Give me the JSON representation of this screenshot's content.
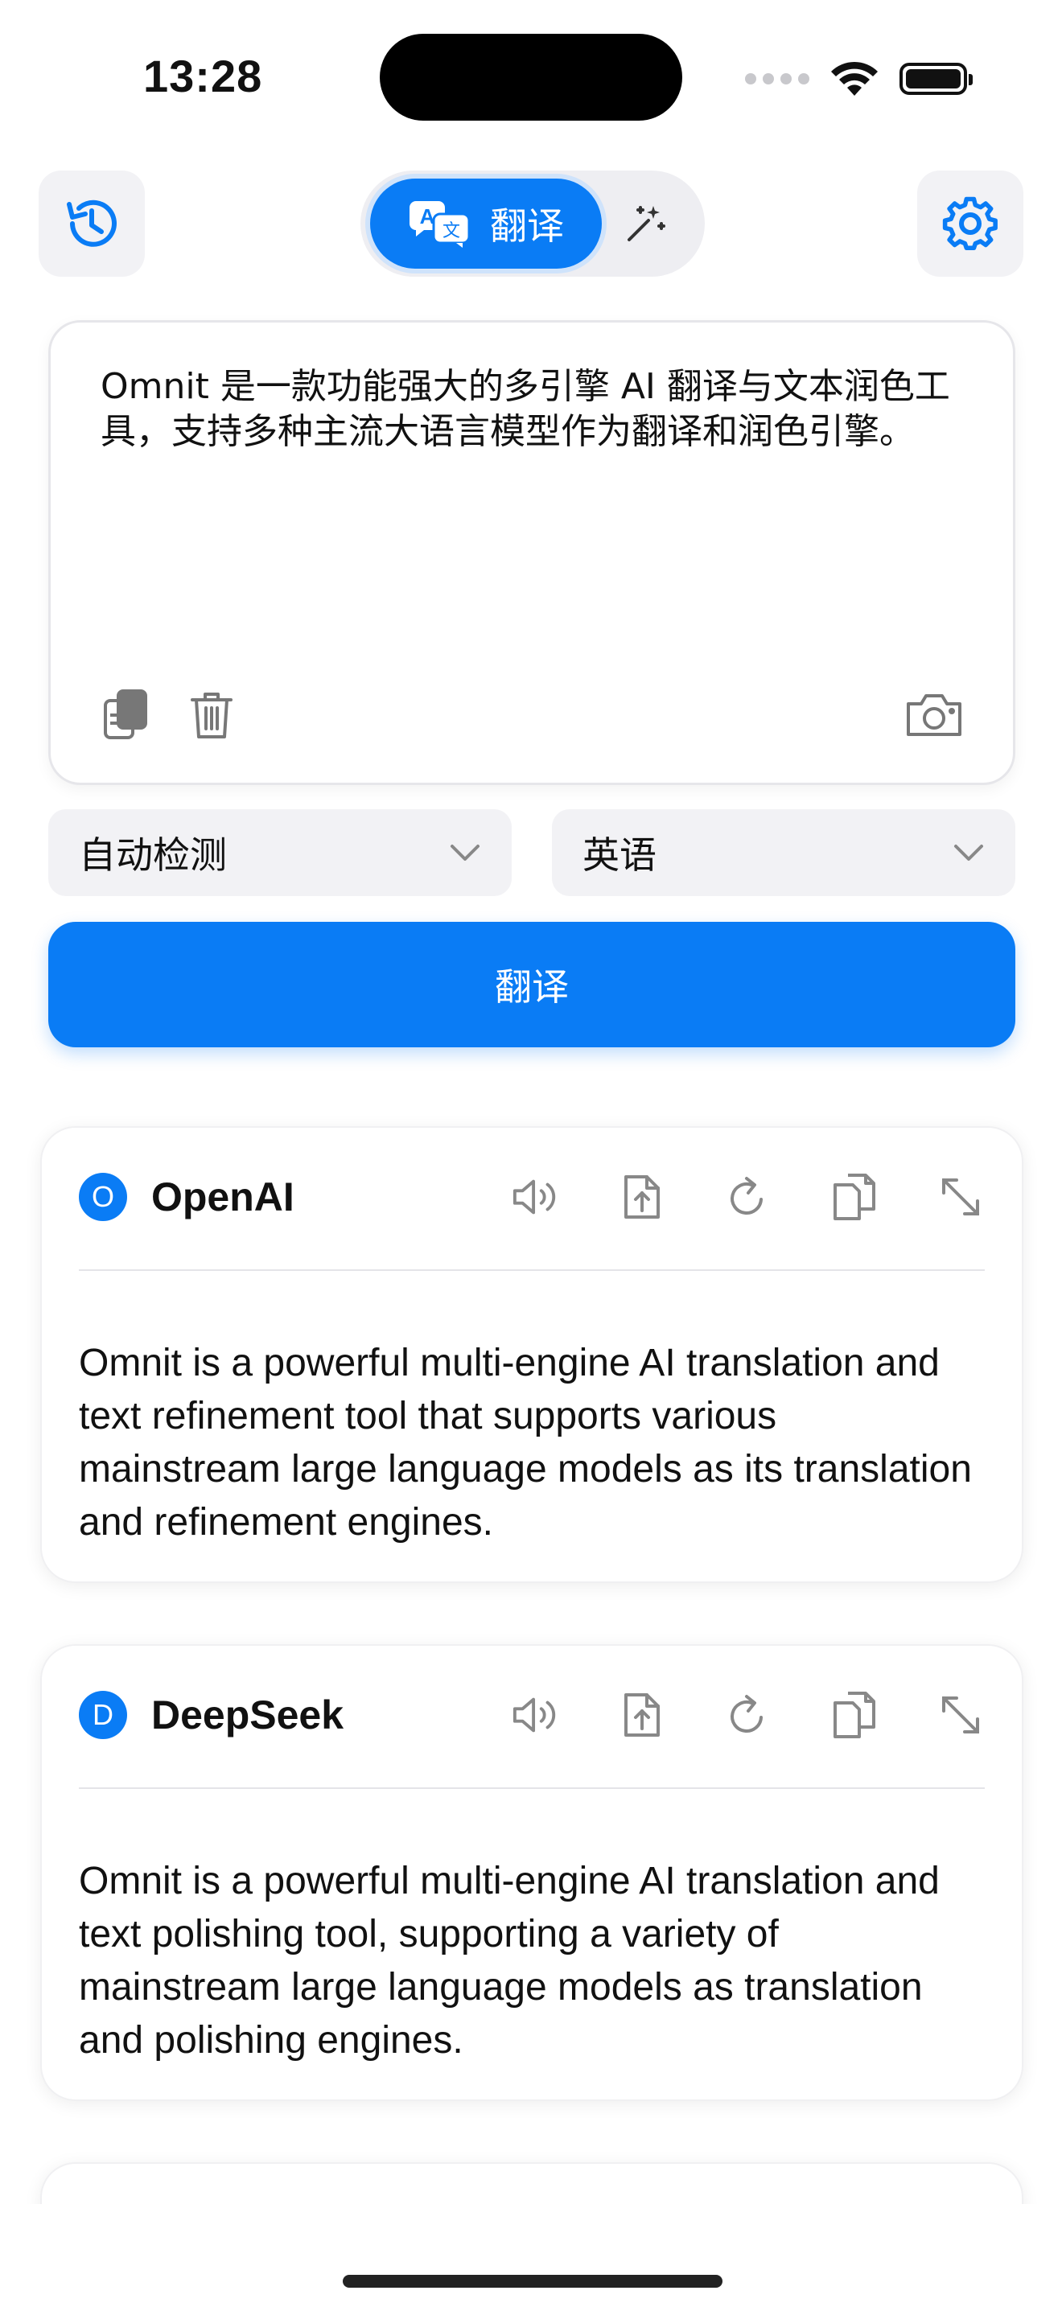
{
  "status_bar": {
    "time": "13:28"
  },
  "toolbar": {
    "history_icon": "history-clock-icon",
    "settings_icon": "gear-icon",
    "mode_switch": {
      "active_label": "翻译",
      "active_icon": "translate-icon",
      "inactive_icon": "magic-wand-icon"
    }
  },
  "input": {
    "text": "Omnit 是一款功能强大的多引擎 AI 翻译与文本润色工具，支持多种主流大语言模型作为翻译和润色引擎。",
    "actions": [
      "paste-icon",
      "trash-icon",
      "camera-icon"
    ]
  },
  "languages": {
    "source": "自动检测",
    "target": "英语"
  },
  "translate_button": {
    "label": "翻译"
  },
  "results": [
    {
      "badge": "O",
      "engine": "OpenAI",
      "text": "Omnit is a powerful multi-engine AI translation and text refinement tool that supports various mainstream large language models as its translation and refinement engines."
    },
    {
      "badge": "D",
      "engine": "DeepSeek",
      "text": "Omnit is a powerful multi-engine AI translation and text polishing tool, supporting a variety of mainstream large language models as translation and polishing engines."
    }
  ],
  "card_tools": [
    "speaker-icon",
    "export-icon",
    "refresh-icon",
    "copy-icon",
    "expand-icon"
  ],
  "colors": {
    "accent": "#0a7cf5",
    "surface": "#f2f2f5"
  }
}
